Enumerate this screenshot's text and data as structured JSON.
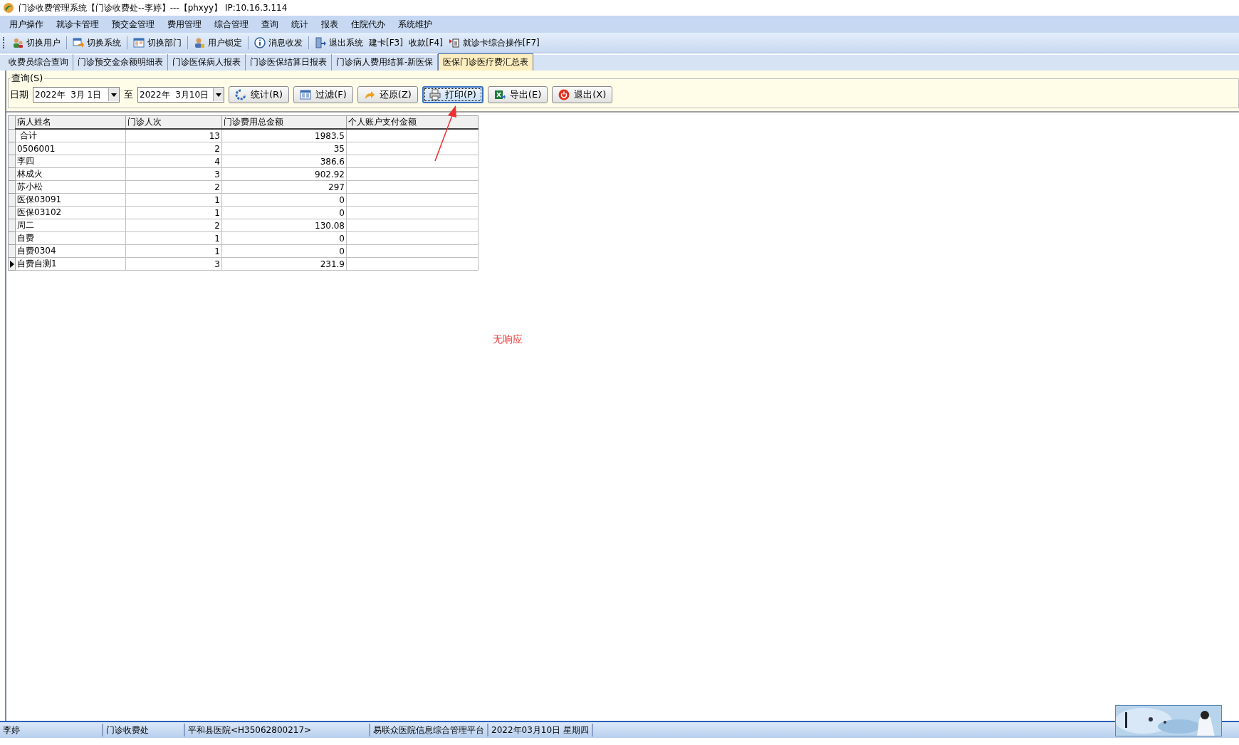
{
  "window": {
    "title": "门诊收费管理系统【门诊收费处--李婷】---【phxyy】 IP:10.16.3.114"
  },
  "menu": [
    "用户操作",
    "就诊卡管理",
    "预交金管理",
    "费用管理",
    "综合管理",
    "查询",
    "统计",
    "报表",
    "住院代办",
    "系统维护"
  ],
  "toolbar": [
    {
      "label": "切换用户",
      "kind": "users"
    },
    {
      "label": "切换系统",
      "kind": "switch"
    },
    {
      "label": "切换部门",
      "kind": "dept"
    },
    {
      "label": "用户锁定",
      "kind": "lock"
    },
    {
      "label": "消息收发",
      "kind": "info"
    },
    {
      "label": "退出系统",
      "kind": "exit"
    },
    {
      "label": "建卡[F3]",
      "kind": "text"
    },
    {
      "label": "收款[F4]",
      "kind": "text"
    },
    {
      "label": "就诊卡综合操作[F7]",
      "kind": "card"
    }
  ],
  "tabs": [
    {
      "label": "收费员综合查询",
      "selected": false
    },
    {
      "label": "门诊预交金余额明细表",
      "selected": false
    },
    {
      "label": "门诊医保病人报表",
      "selected": false
    },
    {
      "label": "门诊医保结算日报表",
      "selected": false
    },
    {
      "label": "门诊病人费用结算-新医保",
      "selected": false
    },
    {
      "label": "医保门诊医疗费汇总表",
      "selected": true
    }
  ],
  "query": {
    "title": "查询(S)",
    "date_label": "日期",
    "from": "2022年  3月 1日",
    "to_label": "至",
    "to": "2022年  3月10日",
    "buttons": [
      {
        "label": "统计(R)",
        "kind": "refresh",
        "focused": false
      },
      {
        "label": "过滤(F)",
        "kind": "filter",
        "focused": false
      },
      {
        "label": "还原(Z)",
        "kind": "undo",
        "focused": false
      },
      {
        "label": "打印(P)",
        "kind": "print",
        "focused": true
      },
      {
        "label": "导出(E)",
        "kind": "excel",
        "focused": false
      },
      {
        "label": "退出(X)",
        "kind": "power",
        "focused": false
      }
    ]
  },
  "table": {
    "columns": [
      "病人姓名",
      "门诊人次",
      "门诊费用总金额",
      "个人账户支付金额"
    ],
    "rows": [
      {
        "cells": [
          " 合计",
          "13",
          "1983.5",
          ""
        ],
        "selected": false
      },
      {
        "cells": [
          "0506001",
          "2",
          "35",
          ""
        ],
        "selected": false
      },
      {
        "cells": [
          "李四",
          "4",
          "386.6",
          ""
        ],
        "selected": false
      },
      {
        "cells": [
          "林成火",
          "3",
          "902.92",
          ""
        ],
        "selected": false
      },
      {
        "cells": [
          "苏小松",
          "2",
          "297",
          ""
        ],
        "selected": false
      },
      {
        "cells": [
          "医保03091",
          "1",
          "0",
          ""
        ],
        "selected": false
      },
      {
        "cells": [
          "医保03102",
          "1",
          "0",
          ""
        ],
        "selected": false
      },
      {
        "cells": [
          "周二",
          "2",
          "130.08",
          ""
        ],
        "selected": false
      },
      {
        "cells": [
          "自费",
          "1",
          "0",
          ""
        ],
        "selected": false
      },
      {
        "cells": [
          "自费0304",
          "1",
          "0",
          ""
        ],
        "selected": false
      },
      {
        "cells": [
          "自费自测1",
          "3",
          "231.9",
          ""
        ],
        "selected": true
      }
    ]
  },
  "annotation": {
    "text": "无响应"
  },
  "status_bar": [
    "李婷",
    "门诊收费处",
    "平和县医院<H35062800217>",
    "易联众医院信息综合管理平台",
    "2022年03月10日  星期四"
  ]
}
